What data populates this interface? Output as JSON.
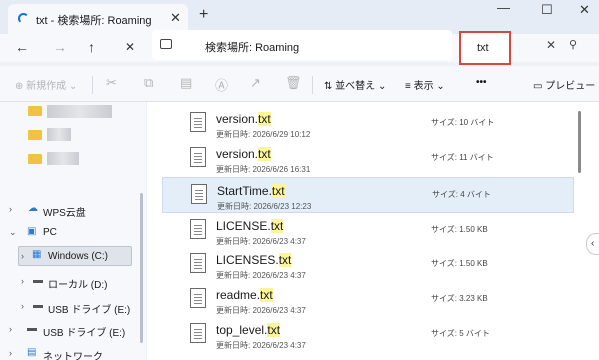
{
  "tab": {
    "title": "txt - 検索場所: Roaming",
    "close": "✕",
    "new": "+"
  },
  "window_controls": {
    "minimize": "—",
    "maximize": "☐",
    "close": "✕"
  },
  "nav": {
    "back": "←",
    "forward": "→",
    "up": "↑",
    "refresh": "✕"
  },
  "address": {
    "text": "検索場所: Roaming"
  },
  "search": {
    "value": "txt",
    "clear": "✕",
    "go": "⚲"
  },
  "commands": {
    "new": "新規作成",
    "sort": "並べ替え",
    "view": "表示",
    "more": "•••",
    "preview": "プレビュー"
  },
  "sidebar": {
    "items": [
      {
        "label": "WPS云盘"
      },
      {
        "label": "PC"
      },
      {
        "label": "Windows (C:)"
      },
      {
        "label": "ローカル (D:)"
      },
      {
        "label": "USB ドライブ (E:)"
      },
      {
        "label": "USB ドライブ (E:)"
      },
      {
        "label": "ネットワーク"
      }
    ]
  },
  "files": [
    {
      "name_prefix": "version.",
      "name_match": "txt",
      "date": "更新日時: 2026/6/29 10:12",
      "size": "サイズ: 10 バイト"
    },
    {
      "name_prefix": "version.",
      "name_match": "txt",
      "date": "更新日時: 2026/6/26 16:31",
      "size": "サイズ: 11 バイト"
    },
    {
      "name_prefix": "StartTime.",
      "name_match": "txt",
      "date": "更新日時: 2026/6/23 12:23",
      "size": "サイズ: 4 バイト"
    },
    {
      "name_prefix": "LICENSE.",
      "name_match": "txt",
      "date": "更新日時: 2026/6/23 4:37",
      "size": "サイズ: 1.50 KB"
    },
    {
      "name_prefix": "LICENSES.",
      "name_match": "txt",
      "date": "更新日時: 2026/6/23 4:37",
      "size": "サイズ: 1.50 KB"
    },
    {
      "name_prefix": "readme.",
      "name_match": "txt",
      "date": "更新日時: 2026/6/23 4:37",
      "size": "サイズ: 3.23 KB"
    },
    {
      "name_prefix": "top_level.",
      "name_match": "txt",
      "date": "更新日時: 2026/6/23 4:37",
      "size": "サイズ: 5 バイト"
    }
  ],
  "colors": {
    "accent": "#1a6fd6",
    "highlight": "#fbf59a",
    "search_border": "#d9463b",
    "selected_row": "#e3eef9"
  }
}
